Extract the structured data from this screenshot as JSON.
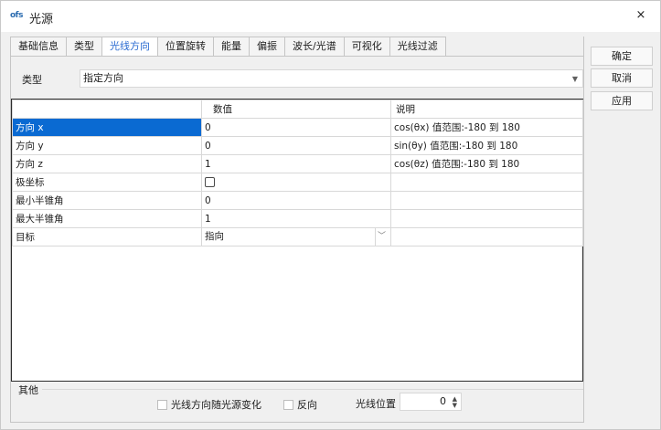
{
  "window": {
    "logo_text": "ofs",
    "title": "光源",
    "close_label": "×"
  },
  "tabs": [
    {
      "label": "基础信息",
      "active": false
    },
    {
      "label": "类型",
      "active": false
    },
    {
      "label": "光线方向",
      "active": true
    },
    {
      "label": "位置旋转",
      "active": false
    },
    {
      "label": "能量",
      "active": false
    },
    {
      "label": "偏振",
      "active": false
    },
    {
      "label": "波长/光谱",
      "active": false
    },
    {
      "label": "可视化",
      "active": false
    },
    {
      "label": "光线过滤",
      "active": false
    }
  ],
  "type_field": {
    "label": "类型",
    "value": "指定方向",
    "arrow": "▼"
  },
  "grid": {
    "headers": [
      "",
      "数值",
      "说明"
    ],
    "rows": [
      {
        "name": "方向 x",
        "value": "0",
        "note": "cos(θx) 值范围:-180 到 180",
        "selected": true
      },
      {
        "name": "方向 y",
        "value": "0",
        "note": "sin(θy) 值范围:-180 到 180"
      },
      {
        "name": "方向 z",
        "value": "1",
        "note": "cos(θz) 值范围:-180 到 180"
      },
      {
        "name": "极坐标",
        "value": "",
        "note": "",
        "checkbox": true
      },
      {
        "name": "最小半锥角",
        "value": "0",
        "note": ""
      },
      {
        "name": "最大半锥角",
        "value": "1",
        "note": ""
      },
      {
        "name": "目标",
        "value": "指向",
        "note": "",
        "combo": true
      }
    ]
  },
  "other": {
    "title": "其他",
    "follow_label": "光线方向随光源变化",
    "reverse_label": "反向",
    "position_label": "光线位置",
    "position_value": "0"
  },
  "buttons": {
    "ok": "确定",
    "cancel": "取消",
    "apply": "应用"
  }
}
